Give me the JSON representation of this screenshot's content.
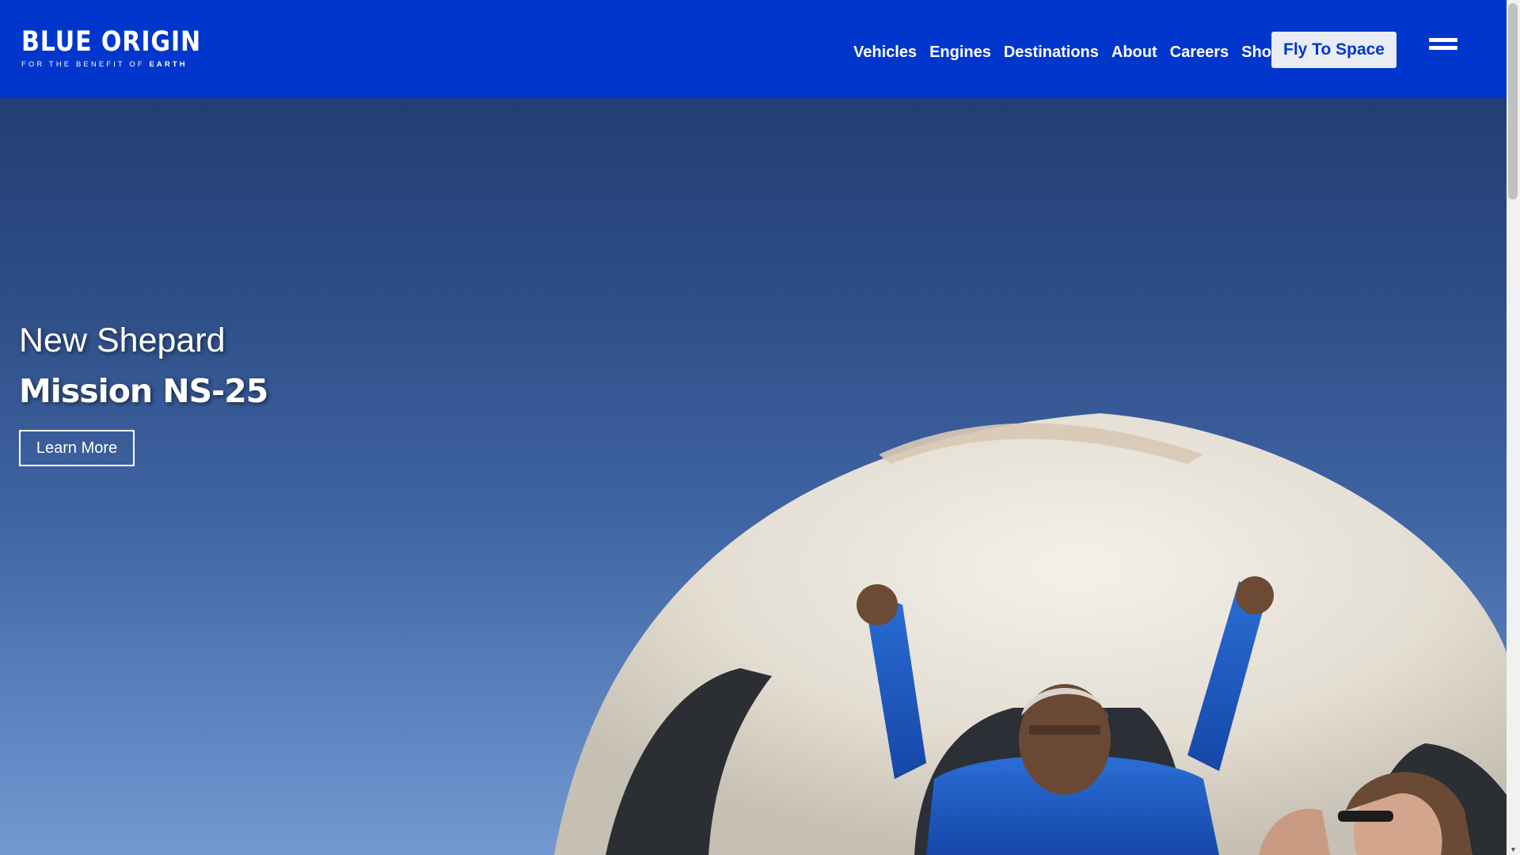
{
  "brand": {
    "name": "BLUE ORIGIN",
    "tagline_prefix": "FOR THE BENEFIT OF",
    "tagline_emphasis": "EARTH"
  },
  "nav": {
    "items": [
      "Vehicles",
      "Engines",
      "Destinations",
      "About",
      "Careers",
      "Shop"
    ],
    "cta_label": "Fly To Space"
  },
  "hero": {
    "subtitle": "New Shepard",
    "title": "Mission NS-25",
    "button_label": "Learn More"
  },
  "colors": {
    "header_bg": "#0036cc",
    "cta_bg": "#e9ecf3",
    "cta_text": "#0036cc"
  },
  "icons": {
    "menu": "hamburger-icon",
    "scroll_down": "arrow-down-icon"
  }
}
